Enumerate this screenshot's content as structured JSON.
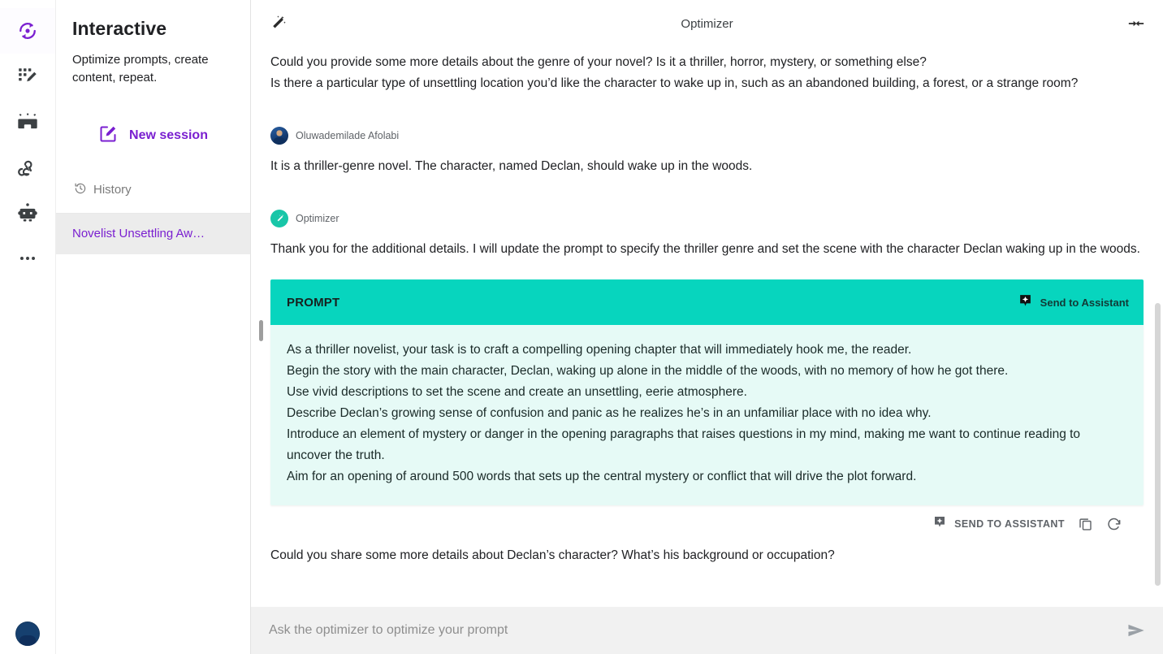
{
  "rail": {
    "items": [
      {
        "name": "optimizer-icon",
        "active": true
      },
      {
        "name": "prompt-grid-edit-icon",
        "active": false
      },
      {
        "name": "toolbox-icon",
        "active": false
      },
      {
        "name": "webhook-icon",
        "active": false
      },
      {
        "name": "robot-icon",
        "active": false
      },
      {
        "name": "more-options-icon",
        "active": false
      }
    ],
    "account_avatar": "user-avatar"
  },
  "sidebar": {
    "title": "Interactive",
    "subtitle": "Optimize prompts, create content, repeat.",
    "new_session_label": "New session",
    "history_label": "History",
    "history_items": [
      {
        "label": "Novelist Unsettling Aw…",
        "selected": true
      }
    ]
  },
  "header": {
    "wand_icon": "magic-wand-icon",
    "title": "Optimizer",
    "collapse_icon": "collapse-horizontal-icon"
  },
  "conversation": {
    "messages": [
      {
        "role": "assistant",
        "lines": [
          "Could you provide some more details about the genre of your novel? Is it a thriller, horror, mystery, or something else?",
          "Is there a particular type of unsettling location you’d like the character to wake up in, such as an abandoned building, a forest, or a strange room?"
        ]
      },
      {
        "role": "user",
        "author": "Oluwademilade Afolabi",
        "lines": [
          "It is a thriller-genre novel. The character, named Declan, should wake up in the woods."
        ]
      },
      {
        "role": "assistant",
        "author": "Optimizer",
        "lines": [
          "Thank you for the additional details. I will update the prompt to specify the thriller genre and set the scene with the character Declan waking up in the woods."
        ]
      }
    ],
    "trailing_message": "Could you share some more details about Declan’s character? What’s his background or occupation?"
  },
  "prompt_card": {
    "header_label": "PROMPT",
    "header_action_label": "Send to Assistant",
    "header_action_icon": "send-to-assistant-icon",
    "body_lines": [
      "As a thriller novelist, your task is to craft a compelling opening chapter that will immediately hook me, the reader.",
      "Begin the story with the main character, Declan, waking up alone in the middle of the woods, with no memory of how he got there.",
      "Use vivid descriptions to set the scene and create an unsettling, eerie atmosphere.",
      "Describe Declan’s growing sense of confusion and panic as he realizes he’s in an unfamiliar place with no idea why.",
      "Introduce an element of mystery or danger in the opening paragraphs that raises questions in my mind, making me want to continue reading to uncover the truth.",
      "Aim for an opening of around 500 words that sets up the central mystery or conflict that will drive the plot forward."
    ],
    "footer_action_label": "SEND TO ASSISTANT",
    "footer_copy_icon": "copy-icon",
    "footer_refresh_icon": "refresh-icon"
  },
  "composer": {
    "placeholder": "Ask the optimizer to optimize your prompt",
    "value": "",
    "send_icon": "send-icon"
  },
  "colors": {
    "accent_purple": "#7a1fd0",
    "teal_header": "#07D5BE",
    "teal_body": "#E6FAF6",
    "avatar_teal": "#18C6A8",
    "composer_bg": "#f1f1f1"
  }
}
